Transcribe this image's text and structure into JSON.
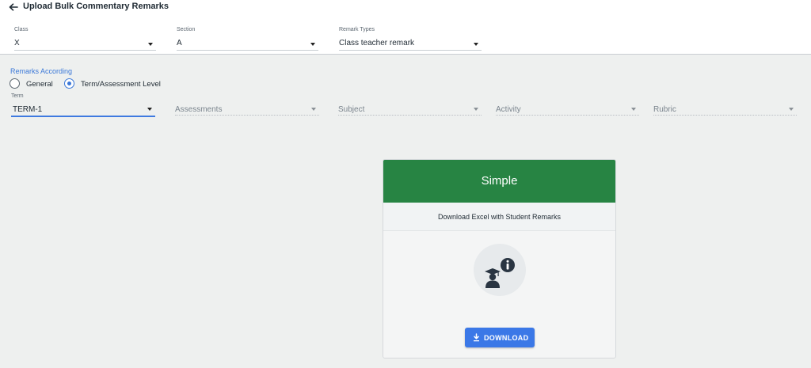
{
  "header": {
    "title": "Upload Bulk Commentary Remarks",
    "back_icon": "arrow-left-icon"
  },
  "filters": {
    "class": {
      "label": "Class",
      "value": "X"
    },
    "section": {
      "label": "Section",
      "value": "A"
    },
    "remark_types": {
      "label": "Remark Types",
      "value": "Class teacher remark"
    }
  },
  "remarks_according": {
    "heading": "Remarks According",
    "options": [
      {
        "label": "General",
        "selected": false
      },
      {
        "label": "Term/Assessment Level",
        "selected": true
      }
    ]
  },
  "level_filters": {
    "term": {
      "label": "Term",
      "value": "TERM-1"
    },
    "assessments": {
      "placeholder": "Assessments"
    },
    "subject": {
      "placeholder": "Subject"
    },
    "activity": {
      "placeholder": "Activity"
    },
    "rubric": {
      "placeholder": "Rubric"
    }
  },
  "card": {
    "title": "Simple",
    "subtitle": "Download Excel with Student Remarks",
    "icon": "student-info-icon",
    "button_label": "DOWNLOAD",
    "button_icon": "download-icon"
  },
  "colors": {
    "accent": "#3b78e7",
    "card_header": "#278443",
    "background": "#eef0ef"
  }
}
